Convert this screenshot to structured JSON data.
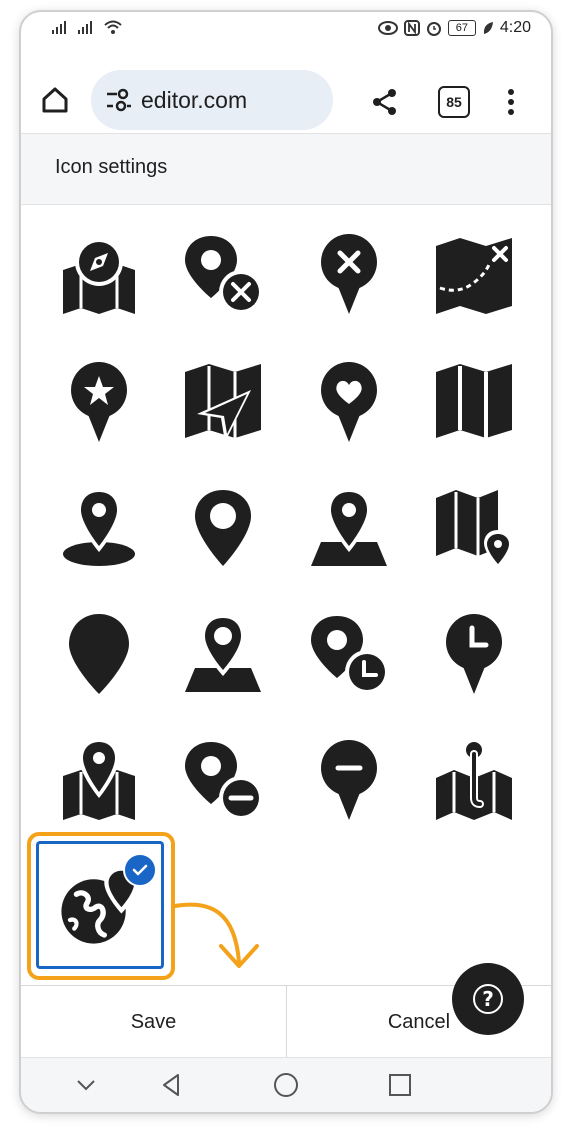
{
  "status_bar": {
    "time": "4:20",
    "battery": "67"
  },
  "browser": {
    "url": "editor.com",
    "tab_count": "85"
  },
  "page": {
    "section_title": "Icon settings"
  },
  "icons": [
    "map-compass-icon",
    "location-pin-remove-icon",
    "pin-close-icon",
    "treasure-map-icon",
    "pin-star-icon",
    "map-navigation-icon",
    "pin-heart-icon",
    "folded-map-icon",
    "pin-on-ground-icon",
    "pin-outline-icon",
    "pin-on-map-icon",
    "map-with-pin-icon",
    "map-marker-filled-icon",
    "pin-on-base-icon",
    "pin-clock-badge-icon",
    "pin-clock-icon",
    "map-with-location-icon",
    "pin-minus-badge-icon",
    "pin-minus-icon",
    "map-pushpin-icon",
    "globe-location-icon"
  ],
  "selected_icon": "globe-location-icon",
  "footer": {
    "save_label": "Save",
    "cancel_label": "Cancel"
  },
  "colors": {
    "accent_blue": "#1a66c6",
    "highlight_orange": "#f5a21b",
    "icon_dark": "#1f1f1f"
  }
}
